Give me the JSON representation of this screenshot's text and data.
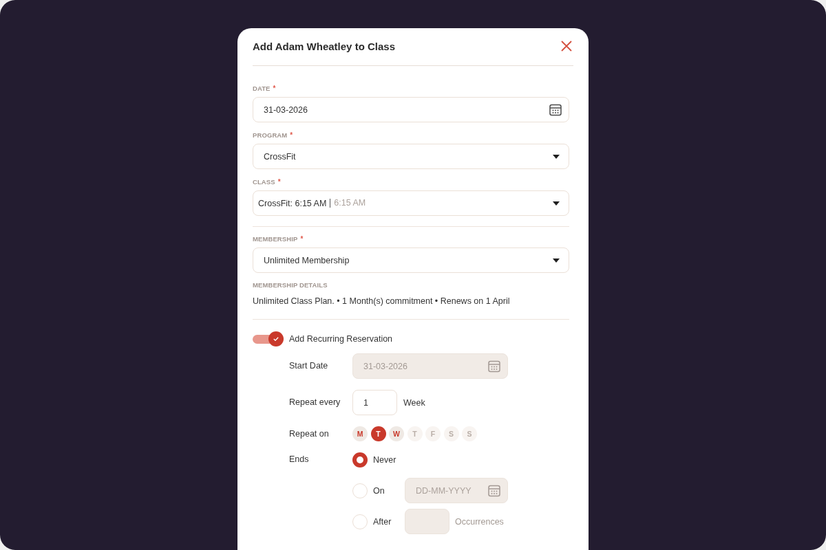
{
  "dialog": {
    "title": "Add Adam Wheatley to Class"
  },
  "sections": [
    {
      "fields": [
        {
          "kind": "date",
          "label": "DATE",
          "required_mark": "*",
          "value": "31-03-2026"
        },
        {
          "kind": "select",
          "label": "PROGRAM",
          "required_mark": "*",
          "value": "CrossFit"
        },
        {
          "kind": "select",
          "label": "CLASS",
          "required_mark": "*",
          "value": "CrossFit: 6:15 AM",
          "detail": "6:15 AM"
        }
      ]
    },
    {
      "fields": [
        {
          "kind": "select",
          "label": "MEMBERSHIP",
          "required_mark": "*",
          "value": "Unlimited Membership"
        }
      ],
      "details": {
        "label": "MEMBERSHIP DETAILS",
        "text": "Unlimited Class Plan. • 1 Month(s) commitment • Renews on 1 April"
      }
    }
  ],
  "recurring": {
    "label": "Add Recurring Reservation",
    "on": true,
    "rows": [
      {
        "kind": "field",
        "label": "Start Date",
        "field": {
          "kind": "date",
          "value": "31-03-2026",
          "disabled": true
        }
      },
      {
        "kind": "field",
        "label": "Repeat every",
        "field": {
          "kind": "number",
          "value": "1",
          "disabled": false
        },
        "unit": "Week"
      },
      {
        "kind": "days",
        "label": "Repeat on",
        "days": [
          {
            "label": "M",
            "selected": false,
            "disabled": false
          },
          {
            "label": "T",
            "selected": true,
            "disabled": false
          },
          {
            "label": "W",
            "selected": false,
            "disabled": false
          },
          {
            "label": "T",
            "selected": false,
            "disabled": true
          },
          {
            "label": "F",
            "selected": false,
            "disabled": true
          },
          {
            "label": "S",
            "selected": false,
            "disabled": true
          },
          {
            "label": "S",
            "selected": false,
            "disabled": true
          }
        ]
      },
      {
        "kind": "ends",
        "label": "Ends",
        "options": [
          {
            "label": "Never",
            "selected": true
          },
          {
            "label": "On",
            "selected": false,
            "field": {
              "kind": "date",
              "placeholder": "DD-MM-YYYY",
              "disabled": true
            }
          },
          {
            "label": "After",
            "selected": false,
            "field": {
              "kind": "number",
              "disabled": true
            },
            "unit": "Occurrences"
          }
        ]
      }
    ]
  }
}
